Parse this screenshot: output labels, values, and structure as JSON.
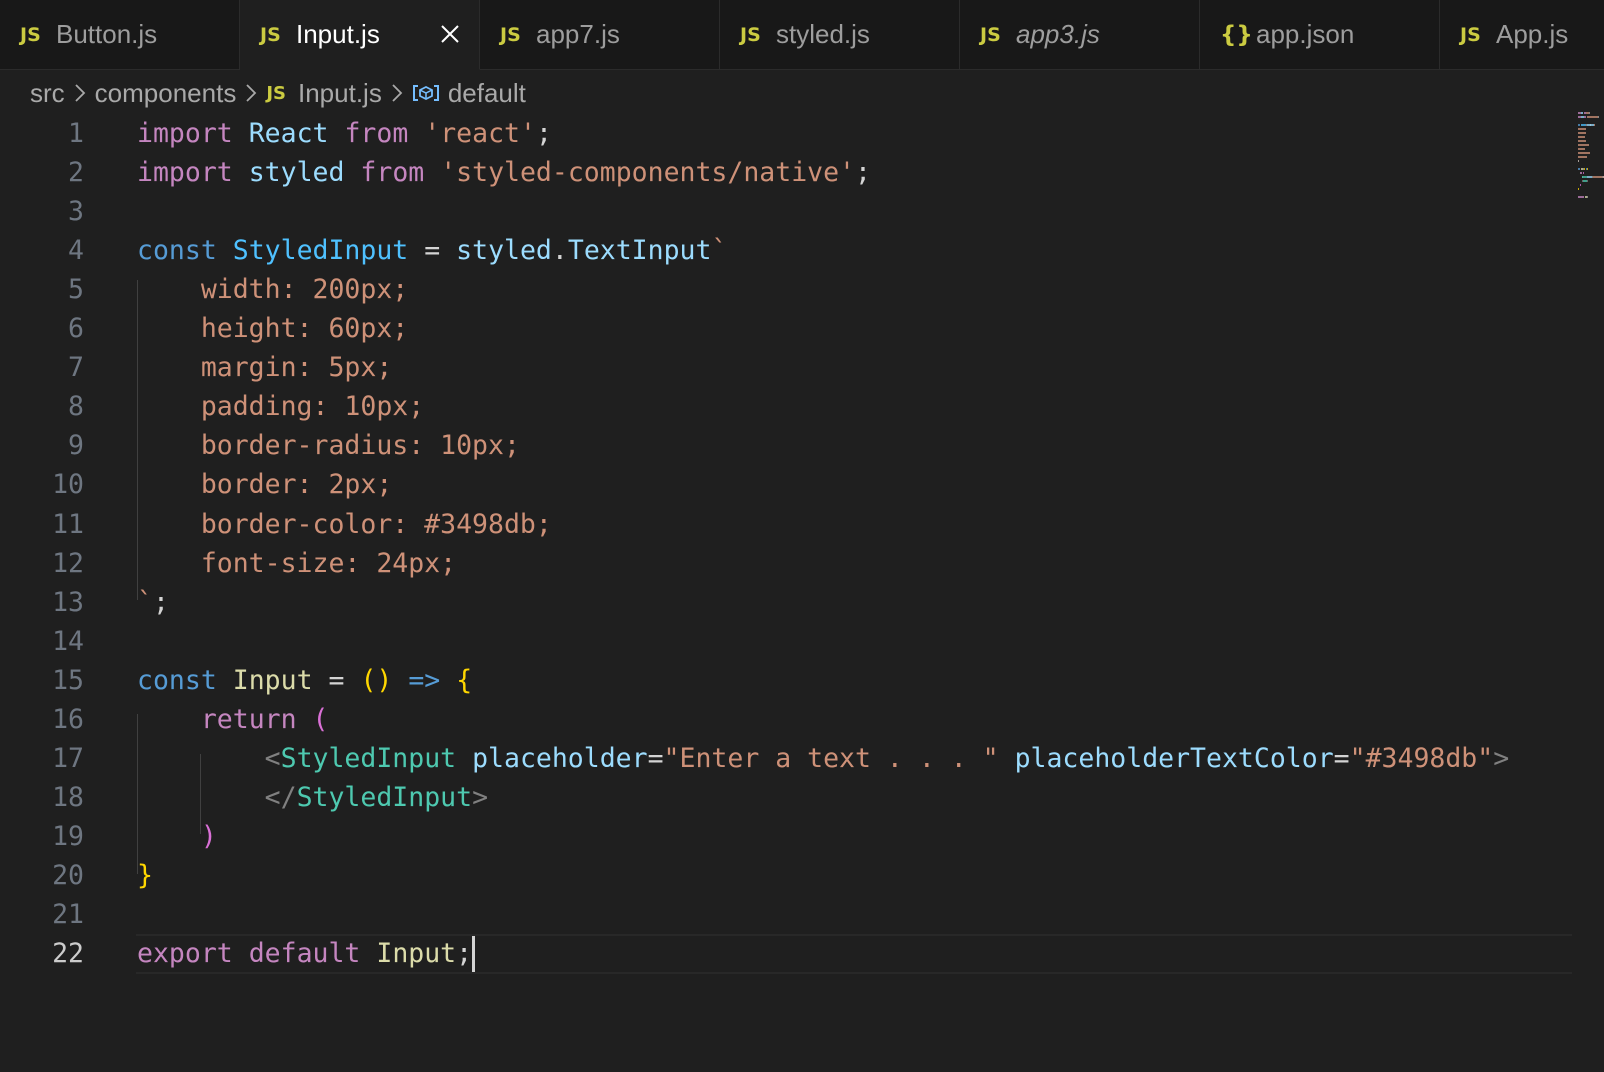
{
  "tabs": [
    {
      "name": "tab-button-js",
      "icon": "JS",
      "icon_name": "javascript-file-icon",
      "label": "Button.js",
      "active": false,
      "italic": false
    },
    {
      "name": "tab-input-js",
      "icon": "JS",
      "icon_name": "javascript-file-icon",
      "label": "Input.js",
      "active": true,
      "italic": false
    },
    {
      "name": "tab-app7-js",
      "icon": "JS",
      "icon_name": "javascript-file-icon",
      "label": "app7.js",
      "active": false,
      "italic": false
    },
    {
      "name": "tab-styled-js",
      "icon": "JS",
      "icon_name": "javascript-file-icon",
      "label": "styled.js",
      "active": false,
      "italic": false
    },
    {
      "name": "tab-app3-js",
      "icon": "JS",
      "icon_name": "javascript-file-icon",
      "label": "app3.js",
      "active": false,
      "italic": true
    },
    {
      "name": "tab-app-json",
      "icon": "{}",
      "icon_name": "json-file-icon",
      "label": "app.json",
      "active": false,
      "italic": false
    },
    {
      "name": "tab-app-js",
      "icon": "JS",
      "icon_name": "javascript-file-icon",
      "label": "App.js",
      "active": false,
      "italic": false
    }
  ],
  "breadcrumb": {
    "folder1": "src",
    "folder2": "components",
    "file_icon": "JS",
    "file": "Input.js",
    "symbol_icon": "symbol-variable-icon",
    "symbol": "default"
  },
  "editor": {
    "current_line": 22,
    "lines": [
      [
        {
          "t": "import",
          "c": "kw"
        },
        {
          "t": " "
        },
        {
          "t": "React",
          "c": "var"
        },
        {
          "t": " "
        },
        {
          "t": "from",
          "c": "kw"
        },
        {
          "t": " "
        },
        {
          "t": "'react'",
          "c": "str"
        },
        {
          "t": ";",
          "c": "punc"
        }
      ],
      [
        {
          "t": "import",
          "c": "kw"
        },
        {
          "t": " "
        },
        {
          "t": "styled",
          "c": "var"
        },
        {
          "t": " "
        },
        {
          "t": "from",
          "c": "kw"
        },
        {
          "t": " "
        },
        {
          "t": "'styled-components/native'",
          "c": "str"
        },
        {
          "t": ";",
          "c": "punc"
        }
      ],
      [],
      [
        {
          "t": "const",
          "c": "sk"
        },
        {
          "t": " "
        },
        {
          "t": "StyledInput",
          "c": "const"
        },
        {
          "t": " "
        },
        {
          "t": "=",
          "c": "punc"
        },
        {
          "t": " "
        },
        {
          "t": "styled",
          "c": "var"
        },
        {
          "t": ".",
          "c": "punc"
        },
        {
          "t": "TextInput",
          "c": "var"
        },
        {
          "t": "`",
          "c": "str"
        }
      ],
      [
        {
          "t": "    width: 200px;",
          "c": "str"
        }
      ],
      [
        {
          "t": "    height: 60px;",
          "c": "str"
        }
      ],
      [
        {
          "t": "    margin: 5px;",
          "c": "str"
        }
      ],
      [
        {
          "t": "    padding: 10px;",
          "c": "str"
        }
      ],
      [
        {
          "t": "    border-radius: 10px;",
          "c": "str"
        }
      ],
      [
        {
          "t": "    border: 2px;",
          "c": "str"
        }
      ],
      [
        {
          "t": "    border-color: #3498db;",
          "c": "str"
        }
      ],
      [
        {
          "t": "    font-size: 24px;",
          "c": "str"
        }
      ],
      [
        {
          "t": "`",
          "c": "str"
        },
        {
          "t": ";",
          "c": "punc"
        }
      ],
      [],
      [
        {
          "t": "const",
          "c": "sk"
        },
        {
          "t": " "
        },
        {
          "t": "Input",
          "c": "fn"
        },
        {
          "t": " "
        },
        {
          "t": "=",
          "c": "punc"
        },
        {
          "t": " "
        },
        {
          "t": "()",
          "c": "br1"
        },
        {
          "t": " "
        },
        {
          "t": "=>",
          "c": "sk"
        },
        {
          "t": " "
        },
        {
          "t": "{",
          "c": "br1"
        }
      ],
      [
        {
          "t": "    "
        },
        {
          "t": "return",
          "c": "kw"
        },
        {
          "t": " "
        },
        {
          "t": "(",
          "c": "br2"
        }
      ],
      [
        {
          "t": "        "
        },
        {
          "t": "<",
          "c": "gray"
        },
        {
          "t": "StyledInput",
          "c": "tag"
        },
        {
          "t": " "
        },
        {
          "t": "placeholder",
          "c": "var"
        },
        {
          "t": "=",
          "c": "punc"
        },
        {
          "t": "\"Enter a text . . . \"",
          "c": "str"
        },
        {
          "t": " "
        },
        {
          "t": "placeholderTextColor",
          "c": "var"
        },
        {
          "t": "=",
          "c": "punc"
        },
        {
          "t": "\"#3498db\"",
          "c": "str"
        },
        {
          "t": ">",
          "c": "gray"
        }
      ],
      [
        {
          "t": "        "
        },
        {
          "t": "</",
          "c": "gray"
        },
        {
          "t": "StyledInput",
          "c": "tag"
        },
        {
          "t": ">",
          "c": "gray"
        }
      ],
      [
        {
          "t": "    "
        },
        {
          "t": ")",
          "c": "br2"
        }
      ],
      [
        {
          "t": "}",
          "c": "br1"
        }
      ],
      [],
      [
        {
          "t": "export",
          "c": "kw"
        },
        {
          "t": " "
        },
        {
          "t": "default",
          "c": "kw"
        },
        {
          "t": " "
        },
        {
          "t": "Input",
          "c": "fn"
        },
        {
          "t": ";",
          "c": "punc"
        }
      ]
    ]
  },
  "colors": {
    "editor_bg": "#1f1f1f",
    "tabbar_bg": "#181818",
    "keyword": "#c586c0",
    "storage": "#569cd6",
    "variable": "#9cdcfe",
    "constant": "#4fc1ff",
    "function": "#dcdcaa",
    "string": "#ce9178",
    "tag": "#4ec9b0",
    "js_icon": "#cbcb41"
  }
}
